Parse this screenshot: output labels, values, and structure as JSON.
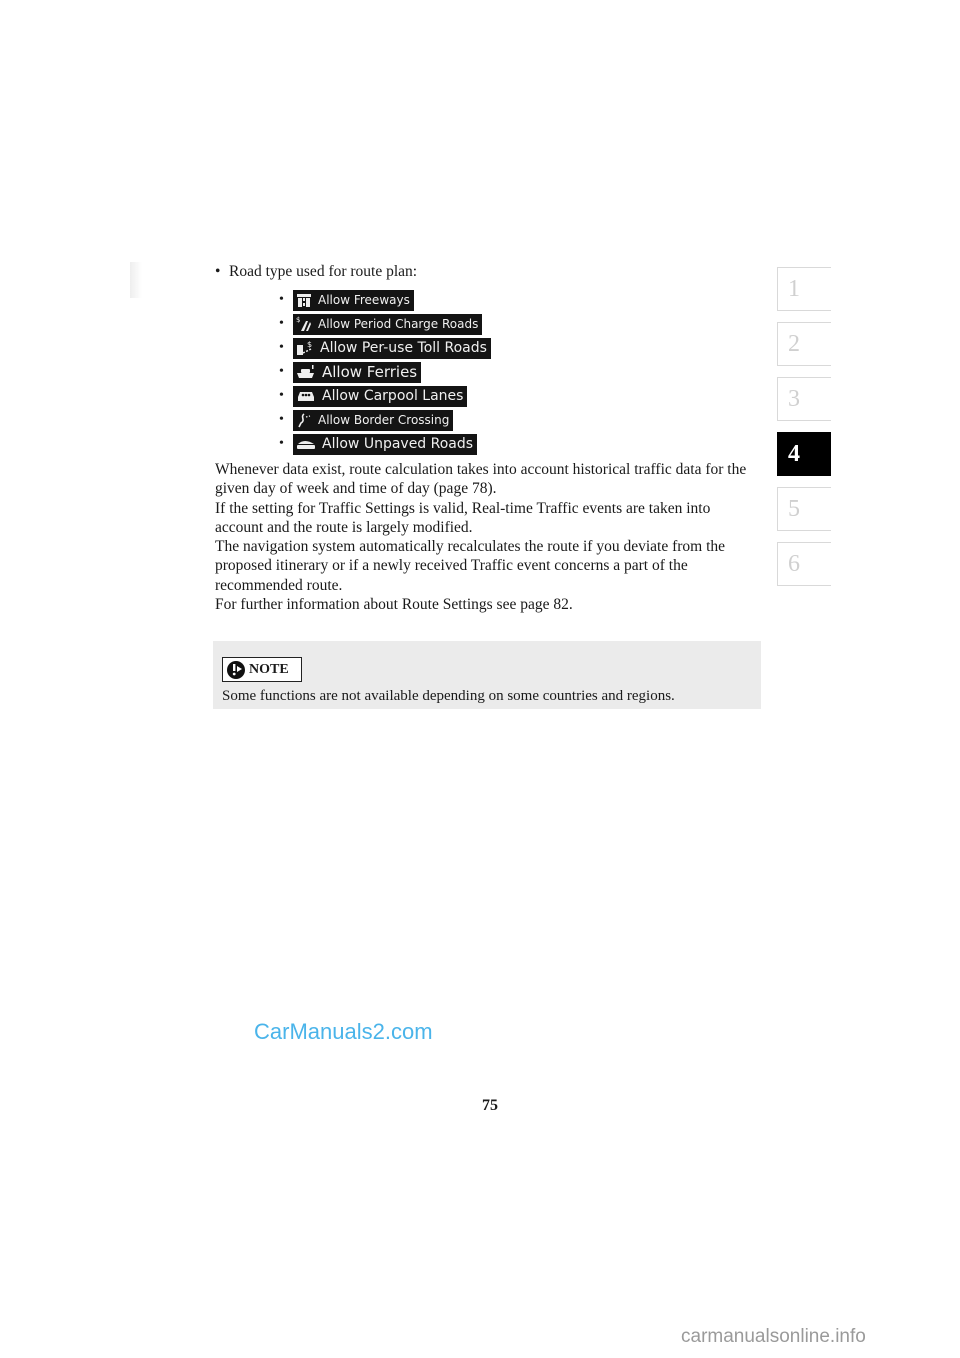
{
  "intro": {
    "bullet": "•",
    "text": "Road type used for route plan:"
  },
  "road_options": [
    {
      "icon": "freeway-icon",
      "label": "Allow Freeways"
    },
    {
      "icon": "period-charge-road-icon",
      "label": "Allow Period Charge Roads"
    },
    {
      "icon": "toll-road-icon",
      "label": "Allow Per-use Toll Roads"
    },
    {
      "icon": "ferry-icon",
      "label": "Allow Ferries"
    },
    {
      "icon": "carpool-icon",
      "label": "Allow Carpool Lanes"
    },
    {
      "icon": "border-crossing-icon",
      "label": "Allow Border Crossing"
    },
    {
      "icon": "unpaved-road-icon",
      "label": "Allow Unpaved Roads"
    }
  ],
  "sub_bullet": "•",
  "paragraphs": [
    "Whenever data exist, route calculation takes into account historical traffic data for the given day of week and time of day (page 78).",
    "If the setting for Traffic Settings is valid, Real-time Traffic events are taken into account and the route is largely modified.",
    "The navigation system automatically recalculates the route if you deviate from the proposed itinerary or if a newly received Traffic event concerns a part of the recommended route.",
    "For further information about Route Settings see page 82."
  ],
  "note": {
    "label": "NOTE",
    "text": "Some functions are not available depending on some countries and regions."
  },
  "chapter_tabs": [
    {
      "label": "1",
      "active": false
    },
    {
      "label": "2",
      "active": false
    },
    {
      "label": "3",
      "active": false
    },
    {
      "label": "4",
      "active": true
    },
    {
      "label": "5",
      "active": false
    },
    {
      "label": "6",
      "active": false
    }
  ],
  "page_number": "75",
  "watermarks": {
    "top": "CarManuals2.com",
    "bottom": "carmanualsonline.info"
  },
  "colors": {
    "watermark_top": "#4ab4ea",
    "watermark_bottom": "#9a9a9a",
    "active_tab": "#000000",
    "note_background": "#ebebeb"
  }
}
